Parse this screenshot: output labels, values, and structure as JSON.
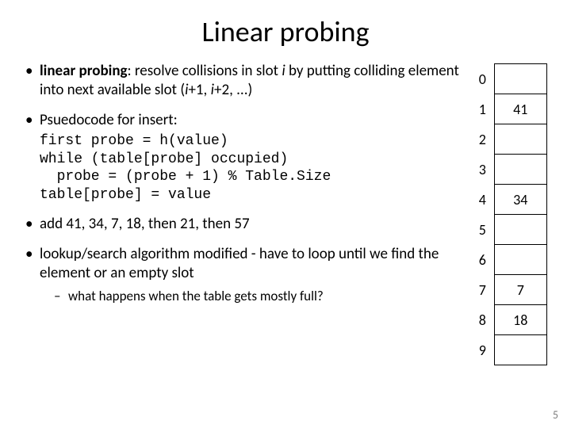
{
  "title": "Linear probing",
  "bullets": {
    "b1_prefix": "linear probing",
    "b1_mid": ": resolve collisions in slot ",
    "b1_i1": "i",
    "b1_mid2": " by putting colliding element into next available slot (",
    "b1_i2": "i",
    "b1_suf2": "+1, ",
    "b1_i3": "i",
    "b1_suf3": "+2, ...)",
    "b2": "Psuedocode for insert:",
    "code": "first probe = h(value)\nwhile (table[probe] occupied)\n  probe = (probe + 1) % Table.Size\ntable[probe] = value",
    "b3": "add 41, 34, 7, 18, then 21, then 57",
    "b4": "lookup/search algorithm modified - have to loop until we find the element or an empty slot",
    "b4_sub": "what happens when the table gets mostly full?"
  },
  "table": {
    "rows": [
      {
        "idx": "0",
        "val": ""
      },
      {
        "idx": "1",
        "val": "41"
      },
      {
        "idx": "2",
        "val": ""
      },
      {
        "idx": "3",
        "val": ""
      },
      {
        "idx": "4",
        "val": "34"
      },
      {
        "idx": "5",
        "val": ""
      },
      {
        "idx": "6",
        "val": ""
      },
      {
        "idx": "7",
        "val": "7"
      },
      {
        "idx": "8",
        "val": "18"
      },
      {
        "idx": "9",
        "val": ""
      }
    ]
  },
  "page_number": "5"
}
